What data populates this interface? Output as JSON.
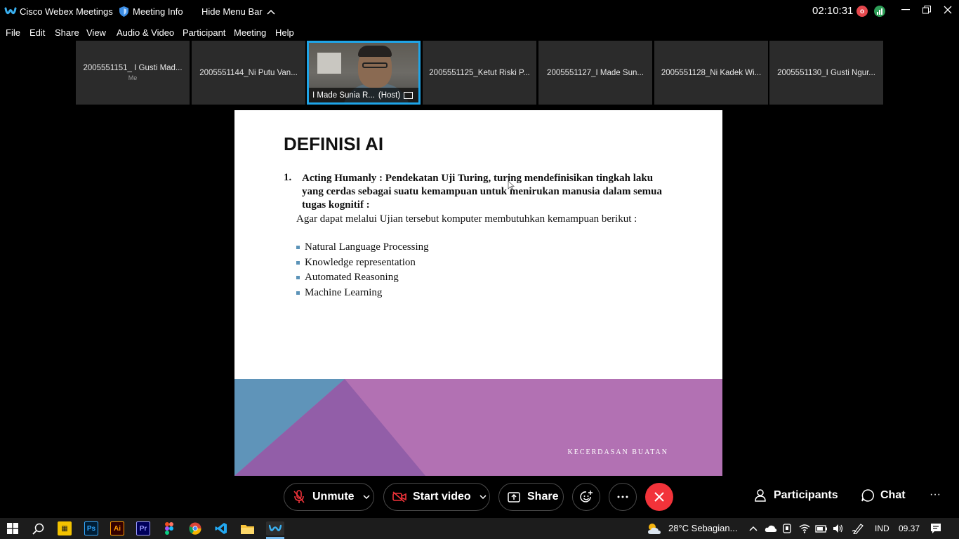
{
  "titlebar": {
    "app_title": "Cisco Webex Meetings",
    "meeting_info": "Meeting Info",
    "hide_menu": "Hide Menu Bar",
    "clock": "02:10:31",
    "rec_badge": "o"
  },
  "menu": [
    "File",
    "Edit",
    "Share",
    "View",
    "Audio & Video",
    "Participant",
    "Meeting",
    "Help"
  ],
  "participants": [
    {
      "name": "2005551151_ I Gusti Mad...",
      "sub": "Me"
    },
    {
      "name": "2005551144_Ni Putu Van..."
    },
    {
      "name": "I Made Sunia R...",
      "role": "(Host)"
    },
    {
      "name": "2005551125_Ketut Riski P..."
    },
    {
      "name": "2005551127_I Made Sun..."
    },
    {
      "name": "2005551128_Ni Kadek Wi..."
    },
    {
      "name": "2005551130_I Gusti Ngur..."
    }
  ],
  "slide": {
    "title": "DEFINISI AI",
    "number": "1.",
    "bold_text": "Acting Humanly : Pendekatan Uji Turing, turing mendefinisikan tingkah laku yang cerdas sebagai suatu kemampuan untuk menirukan manusia dalam semua tugas kognitif :",
    "paragraph": "Agar dapat melalui Ujian tersebut komputer membutuhkan kemampuan berikut :",
    "bullets": [
      "Natural Language Processing",
      "Knowledge representation",
      "Automated Reasoning",
      "Machine Learning"
    ],
    "footer": "KECERDASAN BUATAN",
    "colors": {
      "blue": "#5f94b9",
      "purple_dark": "#925ea8",
      "purple": "#b271b3"
    }
  },
  "controls": {
    "unmute": "Unmute",
    "start_video": "Start video",
    "share": "Share",
    "participants": "Participants",
    "chat": "Chat",
    "more": "···"
  },
  "taskbar": {
    "weather": "28°C  Sebagian...",
    "language": "IND",
    "time": "09.37"
  },
  "colors": {
    "accent": "#1fa5e8",
    "end_call": "#f2333a",
    "rec": "#e5484d",
    "stats": "#2e9e57"
  }
}
